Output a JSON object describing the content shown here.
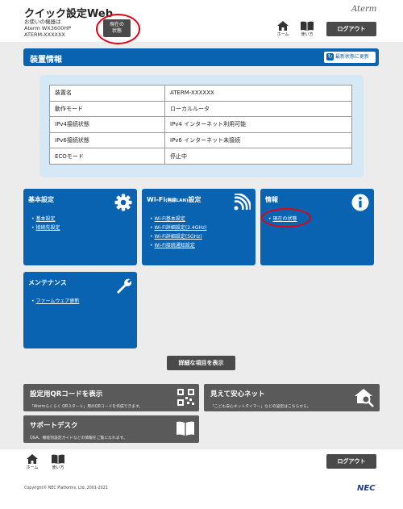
{
  "header": {
    "app_title": "クイック設定Web",
    "device_lines": [
      "お使いの機器は",
      "Aterm WX3600HP",
      "ATERM-XXXXXX"
    ],
    "status_button": [
      "現在の",
      "状態"
    ],
    "brand": "Aterm",
    "home_label": "ホーム",
    "help_label": "使い方",
    "logout_label": "ログアウト"
  },
  "device": {
    "title": "装置情報",
    "refresh_label": "最新状態に更新",
    "rows": [
      {
        "key": "装置名",
        "value": "ATERM-XXXXXX"
      },
      {
        "key": "動作モード",
        "value": "ローカルルータ"
      },
      {
        "key": "IPv4接続状態",
        "value": "IPv4 インターネット利用可能"
      },
      {
        "key": "IPv6接続状態",
        "value": "IPv6 インターネット未接続"
      },
      {
        "key": "ECOモード",
        "value": "停止中"
      }
    ]
  },
  "cards": {
    "basic": {
      "title": "基本設定",
      "links": [
        "基本設定",
        "接続先設定"
      ],
      "icon": "gear-icon"
    },
    "wifi": {
      "title": "Wi-Fi",
      "title_small": "(無線LAN)",
      "title_suffix": "設定",
      "links": [
        "Wi-Fi基本設定",
        "Wi-Fi詳細設定(2.4GHz)",
        "Wi-Fi詳細設定(5GHz)",
        "Wi-Fi接続通知設定"
      ],
      "icon": "wifi-icon"
    },
    "info": {
      "title": "情報",
      "links": [
        "現在の状態"
      ],
      "icon": "info-icon"
    },
    "maintenance": {
      "title": "メンテナンス",
      "links": [
        "ファームウェア更新"
      ],
      "icon": "wrench-icon"
    }
  },
  "detail_button": "詳細な項目を表示",
  "tiles": {
    "qr": {
      "title": "設定用QRコードを表示",
      "desc": "「Atermらくらく QRスタート」用のQRコードを作成できます。",
      "icon": "qr-code-icon"
    },
    "safety": {
      "title": "見えて安心ネット",
      "desc": "「こども安心ネットタイマー」などの設定はこちらから。",
      "icon": "house-search-icon"
    },
    "support": {
      "title": "サポートデスク",
      "desc": "Q&A、機能別設定ガイドなどの情報をご覧になれます。",
      "icon": "book-icon"
    }
  },
  "footer": {
    "home_label": "ホーム",
    "help_label": "使い方",
    "logout_label": "ログアウト",
    "copyright": "Copyright© NEC Platforms, Ltd. 2001-2021",
    "nec": "NEC"
  },
  "colors": {
    "primary": "#0a63b0",
    "panel": "#d5e8f6",
    "dark_button": "#4a4a4a",
    "annotation": "#e60012"
  }
}
